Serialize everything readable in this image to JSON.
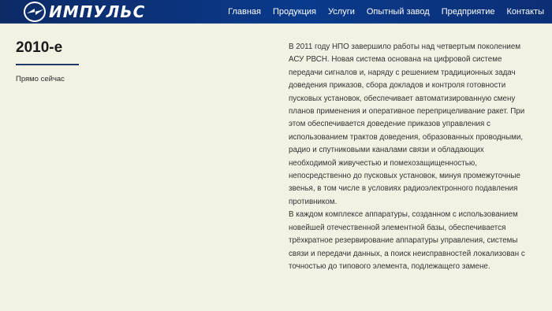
{
  "header": {
    "logo_text": "ИМПУЛЬС",
    "nav": [
      {
        "label": "Главная"
      },
      {
        "label": "Продукция"
      },
      {
        "label": "Услуги"
      },
      {
        "label": "Опытный завод"
      },
      {
        "label": "Предприятие"
      },
      {
        "label": "Контакты"
      }
    ]
  },
  "period": {
    "title": "2010-е",
    "subtitle": "Прямо сейчас"
  },
  "content": {
    "paragraphs": [
      "В 2011 году НПО завершило работы над четвертым поколением АСУ РВСН. Новая система основана на цифровой системе передачи сигналов и, наряду с решением традиционных задач доведения приказов, сбора докладов и контроля готовности пусковых установок, обеспечивает автоматизированную смену планов применения и оперативное переприцеливание ракет. При этом обеспечивается доведение приказов управления с использованием трактов доведения, образованных проводными, радио и спутниковыми каналами связи и обладающих необходимой живучестью и помехозащищенностью, непосредственно до пусковых установок, минуя промежуточные звенья, в том числе в условиях радиоэлектронного подавления противником.",
      "В каждом комплексе аппаратуры, созданном с использованием новейшей отечественной элементной базы, обеспечивается трёхкратное резервирование аппаратуры управления, системы связи и передачи данных, а поиск неисправностей локализован с точностью до типового элемента, подлежащего замене."
    ]
  },
  "colors": {
    "header_bg": "#0a3a8c",
    "page_bg": "#f3f1e3",
    "accent_line": "#1f3a66"
  }
}
